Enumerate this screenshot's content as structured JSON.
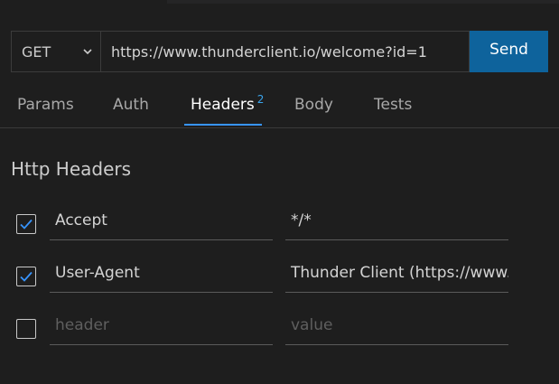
{
  "request": {
    "method": "GET",
    "url": "https://www.thunderclient.io/welcome?id=1",
    "send_label": "Send"
  },
  "tabs": [
    {
      "label": "Params"
    },
    {
      "label": "Auth"
    },
    {
      "label": "Headers",
      "badge": "2",
      "active": true
    },
    {
      "label": "Body"
    },
    {
      "label": "Tests"
    }
  ],
  "headers_section": {
    "title": "Http Headers",
    "rows": [
      {
        "checked": true,
        "key": "Accept",
        "value": "*/*"
      },
      {
        "checked": true,
        "key": "User-Agent",
        "value": "Thunder Client (https://www.thunderclient.io)"
      }
    ],
    "new_row": {
      "checked": false,
      "key_placeholder": "header",
      "value_placeholder": "value"
    }
  },
  "colors": {
    "background": "#1e1e1e",
    "accent": "#0e639c",
    "active_tab_underline": "#3794ff",
    "badge": "#3aa5ee",
    "checkmark": "#3794ff"
  }
}
